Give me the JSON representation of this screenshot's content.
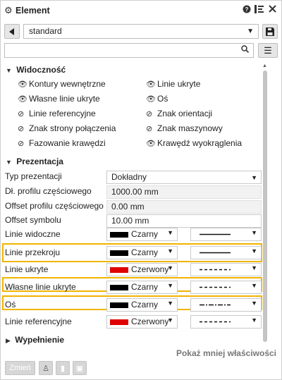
{
  "window": {
    "title": "Element"
  },
  "preset": {
    "value": "standard"
  },
  "search": {
    "placeholder": ""
  },
  "visibility": {
    "title": "Widoczność",
    "left": [
      "Kontury wewnętrzne",
      "Własne linie ukryte",
      "Linie referencyjne",
      "Znak strony połączenia",
      "Fazowanie krawędzi"
    ],
    "right": [
      "Linie ukryte",
      "Oś",
      "Znak orientacji",
      "Znak maszynowy",
      "Krawędź wyokrąglenia"
    ]
  },
  "presentation": {
    "title": "Prezentacja",
    "type_label": "Typ prezentacji",
    "type_value": "Dokładny",
    "partial_label": "Dł. profilu częściowego",
    "partial_value": "1000.00 mm",
    "offset_partial_label": "Offset profilu częściowego",
    "offset_partial_value": "0.00 mm",
    "offset_symbol_label": "Offset symbolu",
    "offset_symbol_value": "10.00 mm",
    "lines": [
      {
        "label": "Linie widoczne",
        "color_name": "Czarny",
        "color": "#000000",
        "style": "solid"
      },
      {
        "label": "Linie przekroju",
        "color_name": "Czarny",
        "color": "#000000",
        "style": "solid"
      },
      {
        "label": "Linie ukryte",
        "color_name": "Czerwony",
        "color": "#e00000",
        "style": "dashed"
      },
      {
        "label": "Własne linie ukryte",
        "color_name": "Czarny",
        "color": "#000000",
        "style": "dashed"
      },
      {
        "label": "Oś",
        "color_name": "Czarny",
        "color": "#000000",
        "style": "dashdot"
      },
      {
        "label": "Linie referencyjne",
        "color_name": "Czerwony",
        "color": "#e00000",
        "style": "dashed"
      }
    ]
  },
  "fill": {
    "title": "Wypełnienie"
  },
  "footer": {
    "less_props": "Pokaż mniej właściwości",
    "modify": "Zmień"
  },
  "colors": {
    "highlight": "#f0b400"
  }
}
